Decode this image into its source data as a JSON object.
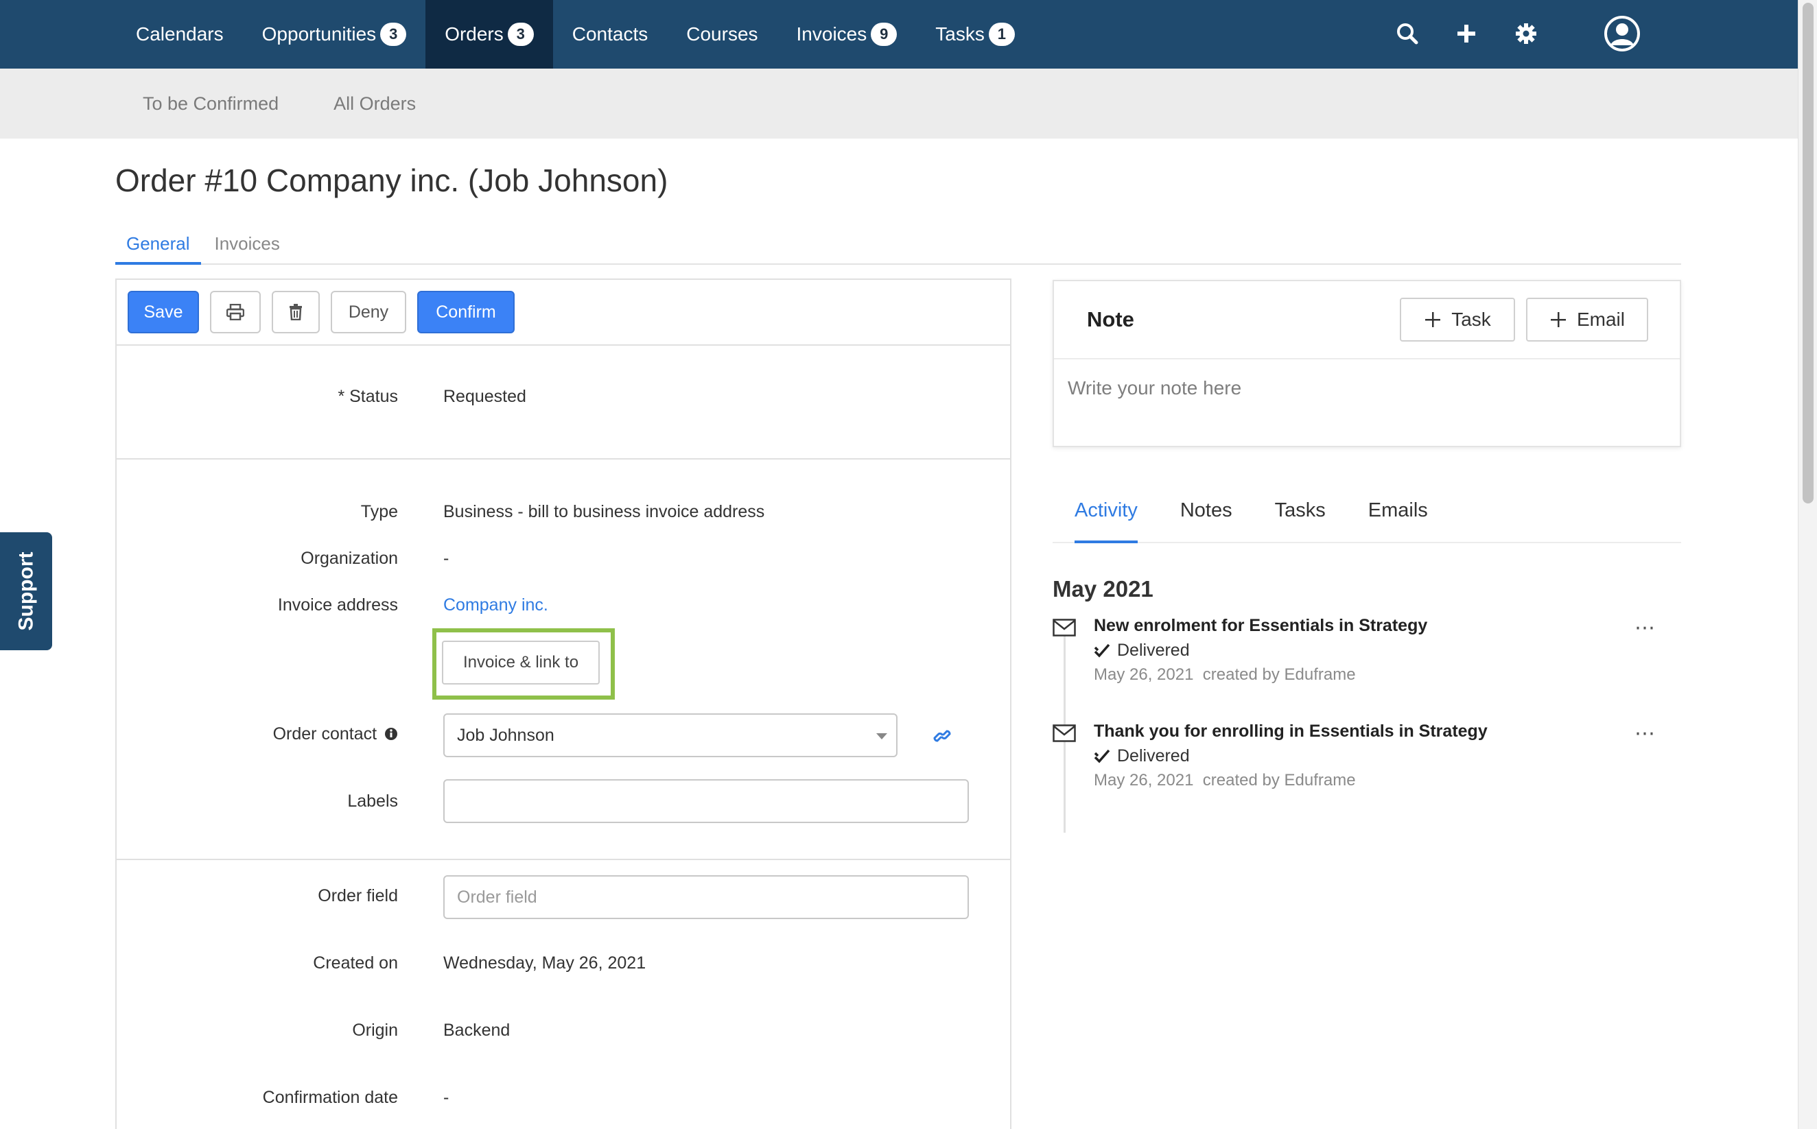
{
  "nav": {
    "items": [
      {
        "label": "Calendars",
        "badge": null
      },
      {
        "label": "Opportunities",
        "badge": "3"
      },
      {
        "label": "Orders",
        "badge": "3"
      },
      {
        "label": "Contacts",
        "badge": null
      },
      {
        "label": "Courses",
        "badge": null
      },
      {
        "label": "Invoices",
        "badge": "9"
      },
      {
        "label": "Tasks",
        "badge": "1"
      }
    ],
    "active_color": "#0f2a44",
    "bg_color": "#1f4a6e"
  },
  "subnav": {
    "items": [
      "To be Confirmed",
      "All Orders"
    ]
  },
  "page": {
    "title": "Order #10 Company inc. (Job Johnson)",
    "tabs": [
      "General",
      "Invoices"
    ]
  },
  "toolbar": {
    "save": "Save",
    "deny": "Deny",
    "confirm": "Confirm"
  },
  "form": {
    "status_label": "* Status",
    "status_value": "Requested",
    "type_label": "Type",
    "type_value": "Business - bill to business invoice address",
    "organization_label": "Organization",
    "organization_value": "-",
    "invoice_address_label": "Invoice address",
    "invoice_address_value": "Company inc.",
    "invoice_link_button": "Invoice & link to",
    "order_contact_label": "Order contact",
    "order_contact_value": "Job Johnson",
    "labels_label": "Labels",
    "labels_value": "",
    "order_field_label": "Order field",
    "order_field_placeholder": "Order field",
    "created_on_label": "Created on",
    "created_on_value": "Wednesday, May 26, 2021",
    "origin_label": "Origin",
    "origin_value": "Backend",
    "confirmation_date_label": "Confirmation date",
    "confirmation_date_value": "-"
  },
  "note": {
    "title": "Note",
    "task_button": "Task",
    "email_button": "Email",
    "placeholder": "Write your note here"
  },
  "activity": {
    "tabs": [
      "Activity",
      "Notes",
      "Tasks",
      "Emails"
    ],
    "month": "May 2021",
    "entries": [
      {
        "subject": "New enrolment for Essentials in Strategy",
        "status": "Delivered",
        "date": "May 26, 2021",
        "created_by": "created by Eduframe"
      },
      {
        "subject": "Thank you for enrolling in Essentials in Strategy",
        "status": "Delivered",
        "date": "May 26, 2021",
        "created_by": "created by Eduframe"
      }
    ]
  },
  "support": {
    "label": "Support"
  },
  "colors": {
    "primary": "#3b82f6",
    "link": "#2f7be2",
    "highlight": "#8fc04a"
  }
}
